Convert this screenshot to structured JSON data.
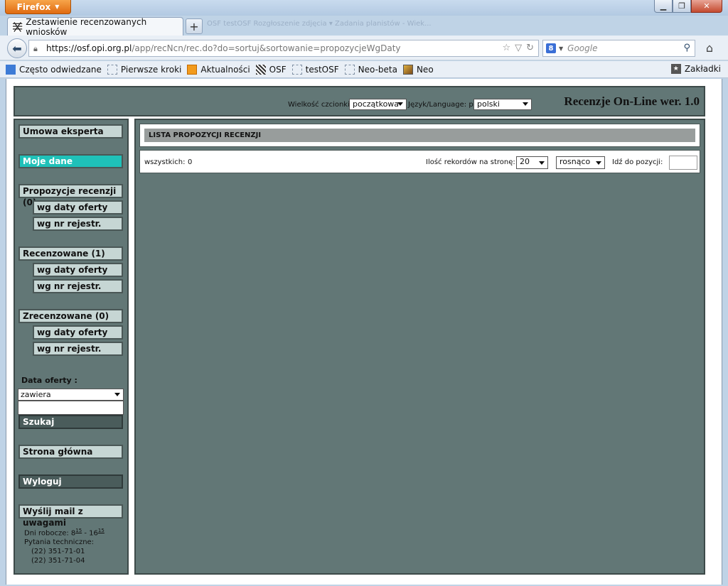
{
  "browser": {
    "menu_label": "Firefox",
    "tab_title": "Zestawienie recenzowanych wniosków",
    "new_tab": "+",
    "background_tabs": "OSF   testOSF   Rozgłoszenie zdjęcia ▾   Zadania planistów - Wiek...",
    "url_host": "https://osf.opi.org.pl",
    "url_path": "/app/recNcn/rec.do?do=sortuj&sortowanie=propozycjeWgDaty",
    "search_placeholder": "Google",
    "bookmarks": [
      {
        "label": "Często odwiedzane",
        "icon": "most-visited-icon"
      },
      {
        "label": "Pierwsze kroki",
        "icon": "page-icon"
      },
      {
        "label": "Aktualności",
        "icon": "rss-icon"
      },
      {
        "label": "OSF",
        "icon": "osf-icon"
      },
      {
        "label": "testOSF",
        "icon": "page-icon"
      },
      {
        "label": "Neo-beta",
        "icon": "page-icon"
      },
      {
        "label": "Neo",
        "icon": "neo-icon"
      }
    ],
    "bookmarks_menu": "Zakładki"
  },
  "header": {
    "font_size_label": "Wielkość czcionki:",
    "font_size_value": "początkowa",
    "language_label": "Język/Language: pl",
    "language_value": "polski",
    "app_title": "Recenzje On-Line wer. 1.0"
  },
  "sidebar": {
    "contract": "Umowa eksperta",
    "my_data": "Moje dane",
    "groups": [
      {
        "title": "Propozycje recenzji (0)",
        "sub1": "wg daty oferty",
        "sub2": "wg nr rejestr."
      },
      {
        "title": "Recenzowane (1)",
        "sub1": "wg daty oferty",
        "sub2": "wg nr rejestr."
      },
      {
        "title": "Zrecenzowane (0)",
        "sub1": "wg daty oferty",
        "sub2": "wg nr rejestr."
      }
    ],
    "date_label": "Data oferty :",
    "date_filter_value": "zawiera",
    "search_button": "Szukaj",
    "home_button": "Strona główna",
    "logout_button": "Wyloguj",
    "mail_button": "Wyślij mail z uwagami",
    "work_days_label": "Dni robocze: 8",
    "work_days_from_sup": "15",
    "work_days_sep": " - 16",
    "work_days_to_sup": "15",
    "tech_label": "Pytania techniczne:",
    "phone1": "(22) 351-71-01",
    "phone2": "(22) 351-71-04"
  },
  "main": {
    "list_title": "LISTA PROPOZYCJI RECENZJI",
    "total_label": "wszystkich:",
    "total_value": "0",
    "per_page_label": "Ilość rekordów na stronę:",
    "per_page_value": "20",
    "order_value": "rosnąco",
    "goto_label": "Idź do pozycji:"
  }
}
